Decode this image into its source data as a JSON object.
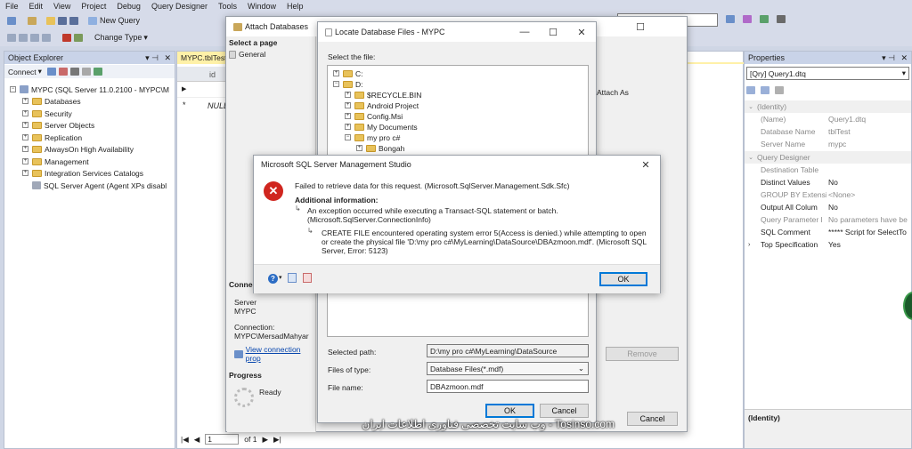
{
  "menu": [
    "File",
    "Edit",
    "View",
    "Project",
    "Debug",
    "Query Designer",
    "Tools",
    "Window",
    "Help"
  ],
  "toolbar": {
    "new_query": "New Query",
    "change_type": "Change Type"
  },
  "object_explorer": {
    "title": "Object Explorer",
    "connect": "Connect",
    "server": "MYPC (SQL Server 11.0.2100 - MYPC\\M",
    "nodes": [
      "Databases",
      "Security",
      "Server Objects",
      "Replication",
      "AlwaysOn High Availability",
      "Management",
      "Integration Services Catalogs",
      "SQL Server Agent (Agent XPs disabl"
    ]
  },
  "query_tab": {
    "tab": "MYPC.tblTest",
    "col": "id",
    "null_cell": "NULL",
    "nav_page": "1",
    "nav_of": "of 1"
  },
  "attach": {
    "title": "Attach Databases",
    "select_page": "Select a page",
    "general": "General",
    "attach_as": "Attach As",
    "conn_header": "Connection",
    "server_label": "Server",
    "server_val": "MYPC",
    "connection_label": "Connection:",
    "connection_val": "MYPC\\MersadMahyar",
    "view_conn": "View connection prop",
    "progress": "Progress",
    "ready": "Ready",
    "remove": "Remove",
    "cancel": "Cancel"
  },
  "locate": {
    "title": "Locate Database Files - MYPC",
    "select_file": "Select the file:",
    "tree": [
      "C:",
      "D:",
      "$RECYCLE.BIN",
      "Android Project",
      "Config.Msi",
      "My Documents",
      "my pro c#",
      "Bongah"
    ],
    "selected_path_label": "Selected path:",
    "selected_path": "D:\\my pro c#\\MyLearning\\DataSource",
    "files_type_label": "Files of type:",
    "files_type": "Database Files(*.mdf)",
    "file_name_label": "File name:",
    "file_name": "DBAzmoon.mdf",
    "ok": "OK",
    "cancel": "Cancel"
  },
  "error": {
    "title": "Microsoft SQL Server Management Studio",
    "line1": "Failed to retrieve data for this request. (Microsoft.SqlServer.Management.Sdk.Sfc)",
    "additional": "Additional information:",
    "line2": "An exception occurred while executing a Transact-SQL statement or batch.",
    "line2b": "(Microsoft.SqlServer.ConnectionInfo)",
    "line3": "CREATE FILE encountered operating system error 5(Access is denied.) while attempting to open",
    "line3b": "or create the physical file 'D:\\my pro c#\\MyLearning\\DataSource\\DBAzmoon.mdf'. (Microsoft SQL",
    "line3c": "Server, Error: 5123)",
    "ok": "OK"
  },
  "properties": {
    "title": "Properties",
    "object": "[Qry] Query1.dtq",
    "sections": {
      "identity": "(Identity)",
      "designer": "Query Designer"
    },
    "rows": [
      {
        "k": "(Name)",
        "v": "Query1.dtq"
      },
      {
        "k": "Database Name",
        "v": "tblTest"
      },
      {
        "k": "Server Name",
        "v": "mypc"
      }
    ],
    "rows2": [
      {
        "k": "Destination Table",
        "v": ""
      },
      {
        "k": "Distinct Values",
        "v": "No"
      },
      {
        "k": "GROUP BY Extensi",
        "v": "<None>"
      },
      {
        "k": "Output All Colum",
        "v": "No"
      },
      {
        "k": "Query Parameter l",
        "v": "No parameters have be"
      },
      {
        "k": "SQL Comment",
        "v": "***** Script for SelectTo"
      },
      {
        "k": "Top Specification",
        "v": "Yes"
      }
    ],
    "footer": "(Identity)"
  },
  "watermark": "وب سایت تخصصی فناوری اطلاعات ایران - Tosinso.com"
}
